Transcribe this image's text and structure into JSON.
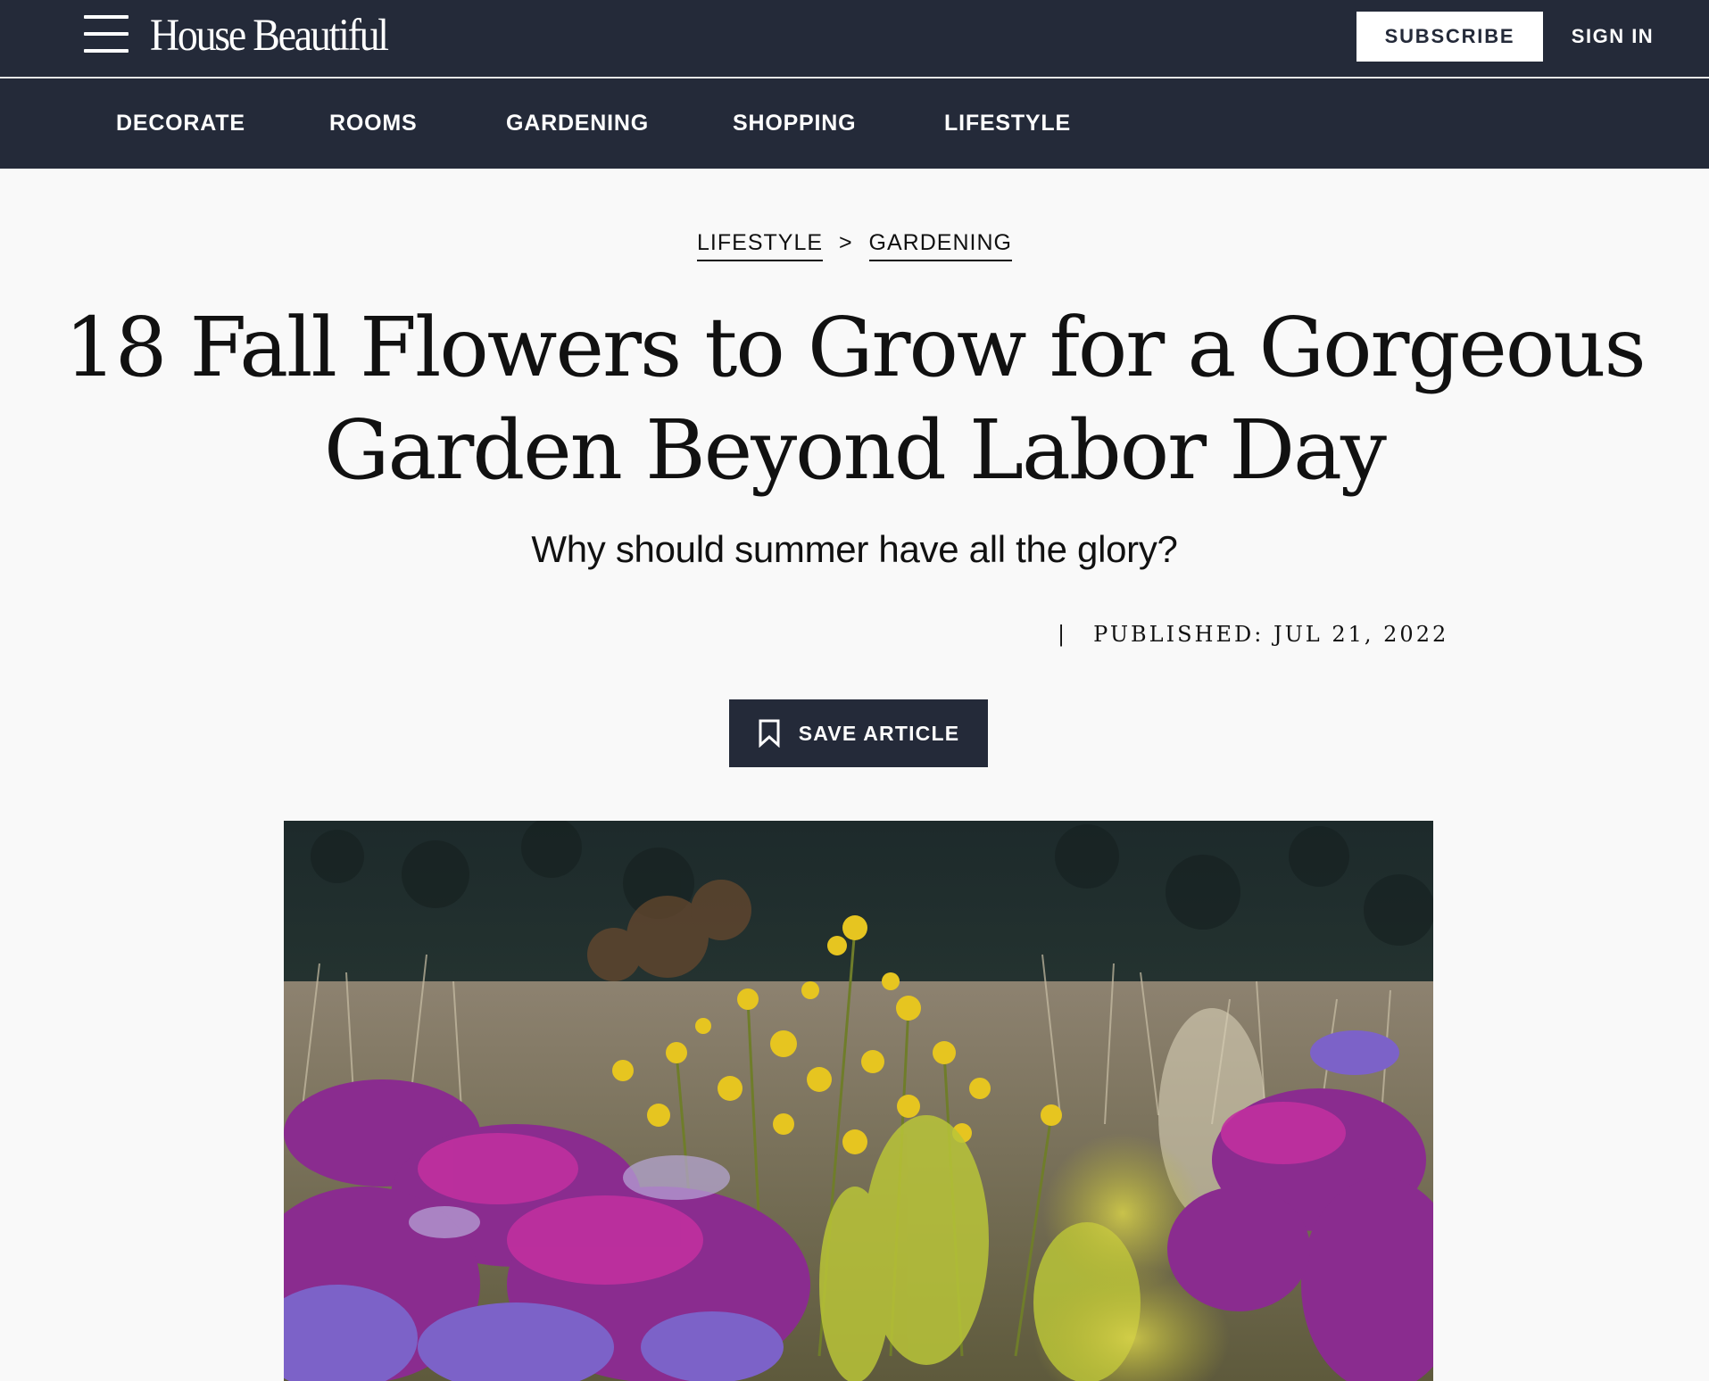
{
  "header": {
    "logo_text": "House Beautiful",
    "subscribe_label": "SUBSCRIBE",
    "signin_label": "SIGN IN"
  },
  "nav": {
    "items": [
      {
        "label": "DECORATE"
      },
      {
        "label": "ROOMS"
      },
      {
        "label": "GARDENING"
      },
      {
        "label": "SHOPPING"
      },
      {
        "label": "LIFESTYLE"
      }
    ]
  },
  "article": {
    "breadcrumb": [
      {
        "label": "LIFESTYLE"
      },
      {
        "label": "GARDENING"
      }
    ],
    "breadcrumb_separator": ">",
    "title_line1": "18 Fall Flowers to Grow for a Gorgeous",
    "title_line2": "Garden Beyond Labor Day",
    "dek": "Why should summer have all the glory?",
    "byline_separator": "|",
    "published": "PUBLISHED: JUL 21, 2022",
    "save_label": "SAVE ARTICLE"
  },
  "theme": {
    "nav_bg": "#242a39",
    "page_bg": "#f9f9f9",
    "text": "#111111"
  },
  "icons": {
    "menu": "hamburger-menu-icon",
    "save": "bookmark-icon"
  }
}
